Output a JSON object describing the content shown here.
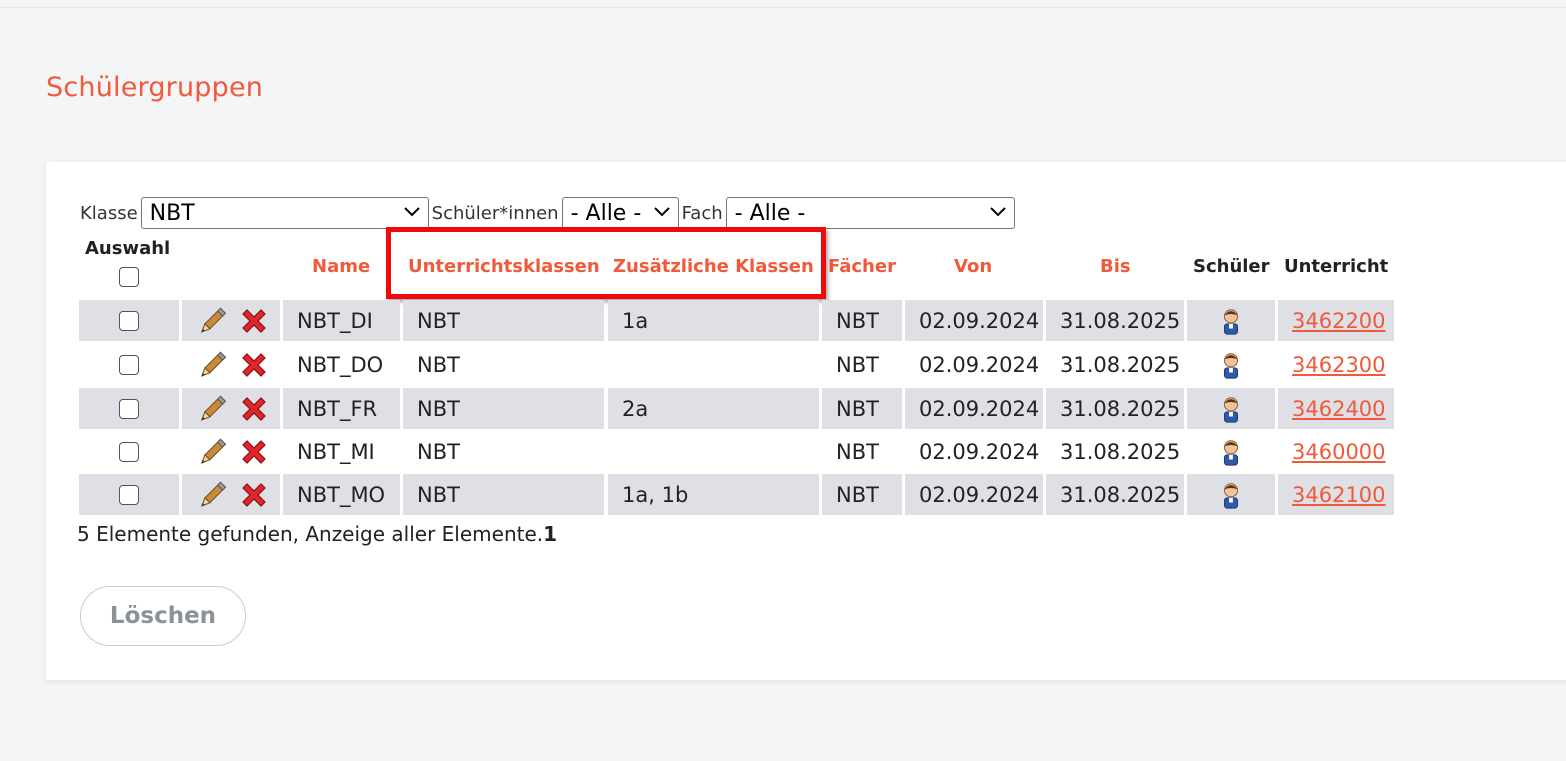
{
  "page": {
    "title": "Schülergruppen"
  },
  "filters": {
    "klasse": {
      "label": "Klasse",
      "value": "NBT"
    },
    "schueler": {
      "label": "Schüler*innen",
      "value": "- Alle -"
    },
    "fach": {
      "label": "Fach",
      "value": "- Alle -"
    }
  },
  "table": {
    "headers": {
      "auswahl": "Auswahl",
      "name": "Name",
      "unterrichtsklassen": "Unterrichtsklassen",
      "zusaetzliche": "Zusätzliche Klassen",
      "faecher": "Fächer",
      "von": "Von",
      "bis": "Bis",
      "schueler": "Schüler",
      "unterricht": "Unterricht"
    },
    "rows": [
      {
        "name": "NBT_DI",
        "unterrichtsklassen": "NBT",
        "zusaetzliche": "1a",
        "faecher": "NBT",
        "von": "02.09.2024",
        "bis": "31.08.2025",
        "unterricht": "3462200"
      },
      {
        "name": "NBT_DO",
        "unterrichtsklassen": "NBT",
        "zusaetzliche": "",
        "faecher": "NBT",
        "von": "02.09.2024",
        "bis": "31.08.2025",
        "unterricht": "3462300"
      },
      {
        "name": "NBT_FR",
        "unterrichtsklassen": "NBT",
        "zusaetzliche": "2a",
        "faecher": "NBT",
        "von": "02.09.2024",
        "bis": "31.08.2025",
        "unterricht": "3462400"
      },
      {
        "name": "NBT_MI",
        "unterrichtsklassen": "NBT",
        "zusaetzliche": "",
        "faecher": "NBT",
        "von": "02.09.2024",
        "bis": "31.08.2025",
        "unterricht": "3460000"
      },
      {
        "name": "NBT_MO",
        "unterrichtsklassen": "NBT",
        "zusaetzliche": "1a, 1b",
        "faecher": "NBT",
        "von": "02.09.2024",
        "bis": "31.08.2025",
        "unterricht": "3462100"
      }
    ]
  },
  "footer": {
    "summary": "5 Elemente gefunden, Anzeige aller Elemente.",
    "page": "1"
  },
  "actions": {
    "delete_label": "Löschen"
  },
  "icons": {
    "edit": "pencil-icon",
    "delete": "red-x-icon",
    "students": "student-person-icon",
    "dropdown": "chevron-down-icon"
  },
  "colors": {
    "accent": "#f0593a",
    "highlight_box": "#f00a0a",
    "row_shade": "#dfe0e6"
  }
}
